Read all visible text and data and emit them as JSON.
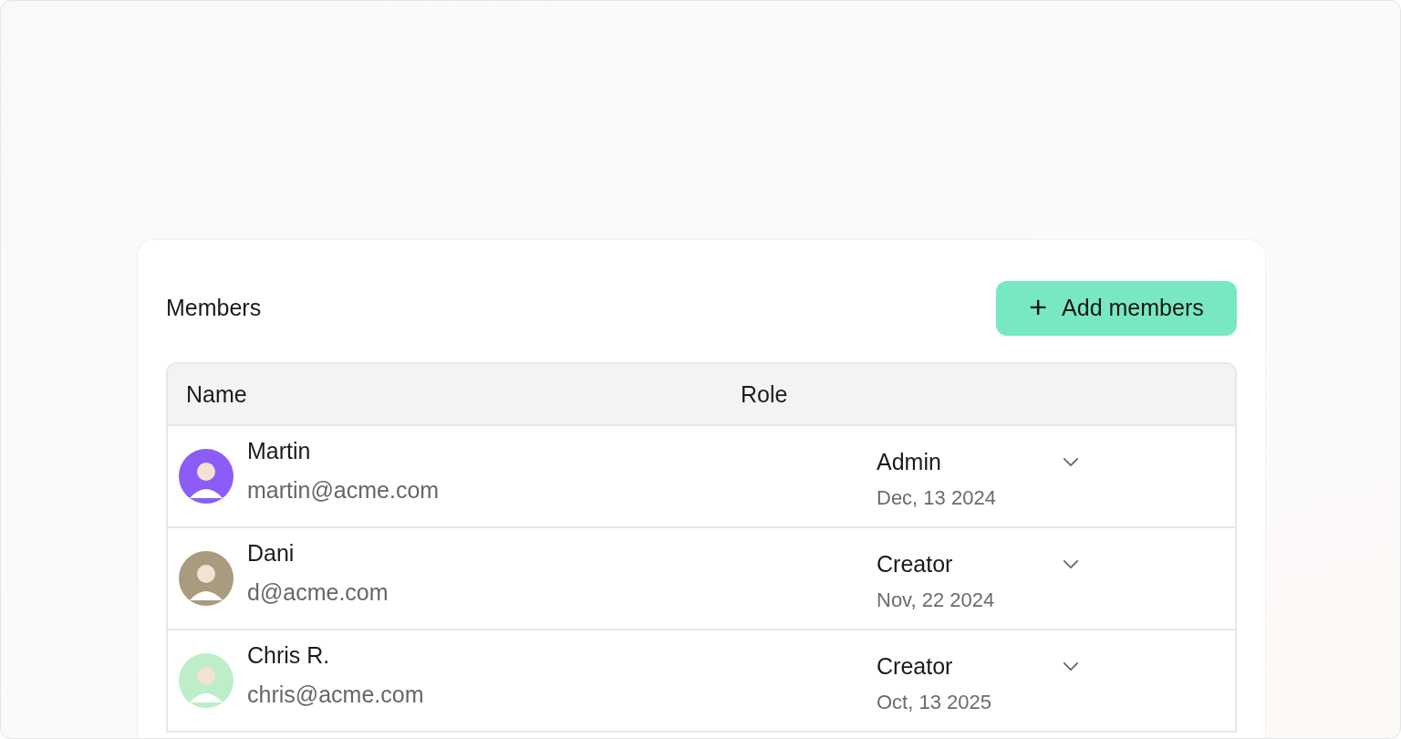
{
  "card": {
    "title": "Members",
    "add_button": {
      "icon": "+",
      "label": "Add members"
    }
  },
  "table": {
    "columns": [
      "Name",
      "Role"
    ],
    "rows": [
      {
        "name": "Martin",
        "email": "martin@acme.com",
        "role": "Admin",
        "date": "Dec, 13 2024",
        "color": "#8b5cf6"
      },
      {
        "name": "Dani",
        "email": "d@acme.com",
        "role": "Creator",
        "date": "Nov, 22 2024",
        "color": "#a89b7e"
      },
      {
        "name": "Chris R.",
        "email": "chris@acme.com",
        "role": "Creator",
        "date": "Oct, 13 2025",
        "color": "#bdeec9"
      }
    ]
  }
}
